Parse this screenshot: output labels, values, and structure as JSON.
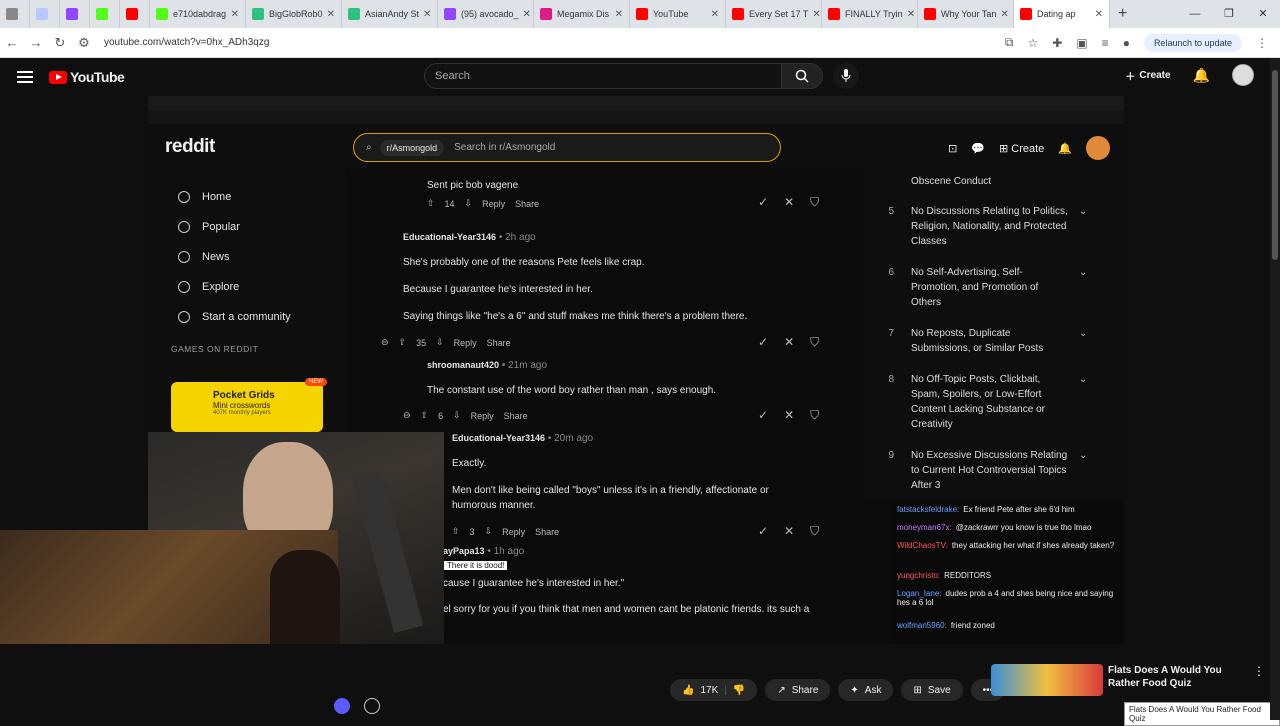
{
  "browser": {
    "tabs": [
      {
        "label": "",
        "color": "#888888"
      },
      {
        "label": "",
        "color": "#b8c7ff"
      },
      {
        "label": "",
        "color": "#9146ff"
      },
      {
        "label": "",
        "color": "#53fc18"
      },
      {
        "label": "",
        "color": "#ff0000"
      },
      {
        "label": "e710dabdrag",
        "color": "#53fc18"
      },
      {
        "label": "BigGlobRob0",
        "color": "#2ec27e"
      },
      {
        "label": "AsianAndy St",
        "color": "#2ec27e"
      },
      {
        "label": "(95) avocado_",
        "color": "#9146ff"
      },
      {
        "label": "Megamix Dis",
        "color": "#e01b84"
      },
      {
        "label": "YouTube",
        "color": "#ff0000"
      },
      {
        "label": "Every Set 17 T",
        "color": "#ff0000"
      },
      {
        "label": "FINALLY Tryin",
        "color": "#ff0000"
      },
      {
        "label": "Why Your Tan",
        "color": "#ff0000"
      },
      {
        "label": "Dating ap",
        "color": "#ff0000"
      }
    ],
    "url": "youtube.com/watch?v=0hx_ADh3qzg",
    "relaunch_label": "Relaunch to update"
  },
  "youtube": {
    "logo_text": "YouTube",
    "search_placeholder": "Search",
    "create_label": "Create"
  },
  "reddit": {
    "logo": "reddit",
    "search_chip": "r/Asmongold",
    "search_placeholder": "Search in r/Asmongold",
    "create_label": "Create",
    "sidebar": [
      {
        "label": "Home",
        "icon": "home-icon"
      },
      {
        "label": "Popular",
        "icon": "popular-icon"
      },
      {
        "label": "News",
        "icon": "news-icon"
      },
      {
        "label": "Explore",
        "icon": "explore-icon"
      },
      {
        "label": "Start a community",
        "icon": "plus-icon"
      }
    ],
    "games_heading": "GAMES ON REDDIT",
    "game_card": {
      "title": "Pocket Grids",
      "subtitle": "Mini crosswords",
      "players": "407K monthly players",
      "badge": "NEW"
    },
    "comments": {
      "c0_text": "Sent pic bob vagene",
      "c0_votes": "14",
      "c1_author": "Educational-Year3146",
      "c1_time": "• 2h ago",
      "c1_p1": "She's probably one of the reasons Pete feels like crap.",
      "c1_p2": "Because I guarantee he's interested in her.",
      "c1_p3": "Saying things like \"he's a 6\" and stuff makes me think there's a problem there.",
      "c1_votes": "35",
      "c2_author": "shroomanaut420",
      "c2_time": "• 21m ago",
      "c2_p1": "The constant use of the word boy rather than man , says enough.",
      "c2_votes": "6",
      "c3_author": "Educational-Year3146",
      "c3_time": "• 20m ago",
      "c3_p1": "Exactly.",
      "c3_p2": "Men don't like being called \"boys\" unless it's in a friendly, affectionate or",
      "c3_p3": "humorous manner.",
      "c3_votes": "3",
      "c4_author": "ayPapa13",
      "c4_time": "• 1h ago",
      "c4_flair": "There it is dood!",
      "c4_p1": "cause I guarantee he's interested in her.\"",
      "c4_p2": "el sorry for you if you think that men and women cant be platonic friends. its such a",
      "reply_label": "Reply",
      "share_label": "Share"
    },
    "rules": {
      "top": "Obscene Conduct",
      "r5_num": "5",
      "r5_text": "No Discussions Relating to Politics, Religion, Nationality, and Protected Classes",
      "r6_num": "6",
      "r6_text": "No Self-Advertising, Self-Promotion, and Promotion of Others",
      "r7_num": "7",
      "r7_text": "No Reposts, Duplicate Submissions, or Similar Posts",
      "r8_num": "8",
      "r8_text": "No Off-Topic Posts, Clickbait, Spam, Spoilers, or Low-Effort Content Lacking Substance or Creativity",
      "r9_num": "9",
      "r9_text": "No Excessive Discussions Relating to Current Hot Controversial Topics After 3"
    }
  },
  "chat": [
    {
      "user": "fatstacksfeldrake:",
      "msg": "Ex friend Pete after she 6'd him",
      "color": "#6aa0ff"
    },
    {
      "user": "moneyman67x:",
      "msg": "@zackrawrr you know is true tho lmao",
      "color": "#c07cff"
    },
    {
      "user": "WildChaosTV:",
      "msg": "they attacking her what if shes already taken?",
      "color": "#ff5a5a"
    },
    {
      "user": "yungchristo:",
      "msg": "REDDITORS",
      "color": "#ff5a5a"
    },
    {
      "user": "Logan_Iane:",
      "msg": "dudes prob a 4 and shes being nice and saying hes a 6 lol",
      "color": "#6aa0ff"
    },
    {
      "user": "wolfman5960:",
      "msg": "friend zoned",
      "color": "#6aa0ff"
    }
  ],
  "video_actions": {
    "likes": "17K",
    "share": "Share",
    "ask": "Ask",
    "save": "Save"
  },
  "next_video": {
    "title": "Flats Does A Would You Rather Food Quiz",
    "tooltip": "Flats Does A Would You Rather Food Quiz"
  }
}
